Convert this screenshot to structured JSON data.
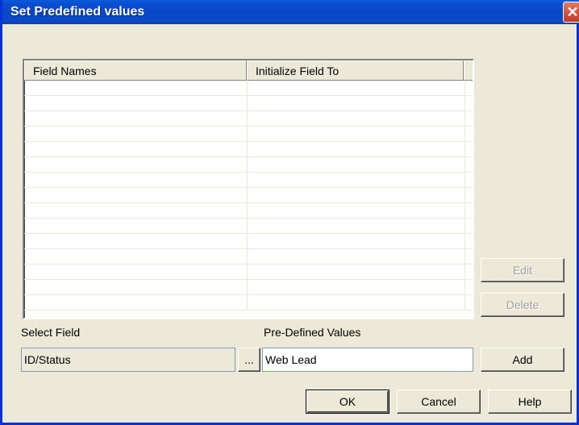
{
  "window": {
    "title": "Set Predefined values",
    "close_glyph": "✕"
  },
  "grid": {
    "columns": [
      "Field Names",
      "Initialize Field To"
    ],
    "rows": [
      [
        "",
        ""
      ],
      [
        "",
        ""
      ],
      [
        "",
        ""
      ],
      [
        "",
        ""
      ],
      [
        "",
        ""
      ],
      [
        "",
        ""
      ],
      [
        "",
        ""
      ],
      [
        "",
        ""
      ],
      [
        "",
        ""
      ],
      [
        "",
        ""
      ],
      [
        "",
        ""
      ],
      [
        "",
        ""
      ],
      [
        "",
        ""
      ],
      [
        "",
        ""
      ],
      [
        "",
        ""
      ]
    ]
  },
  "side_buttons": {
    "edit_label": "Edit",
    "delete_label": "Delete"
  },
  "select_field": {
    "label": "Select Field",
    "value": "ID/Status",
    "browse_label": "..."
  },
  "predefined_values": {
    "label": "Pre-Defined Values",
    "value": "Web Lead"
  },
  "add_button": {
    "label": "Add"
  },
  "footer": {
    "ok_label": "OK",
    "cancel_label": "Cancel",
    "help_label": "Help"
  }
}
